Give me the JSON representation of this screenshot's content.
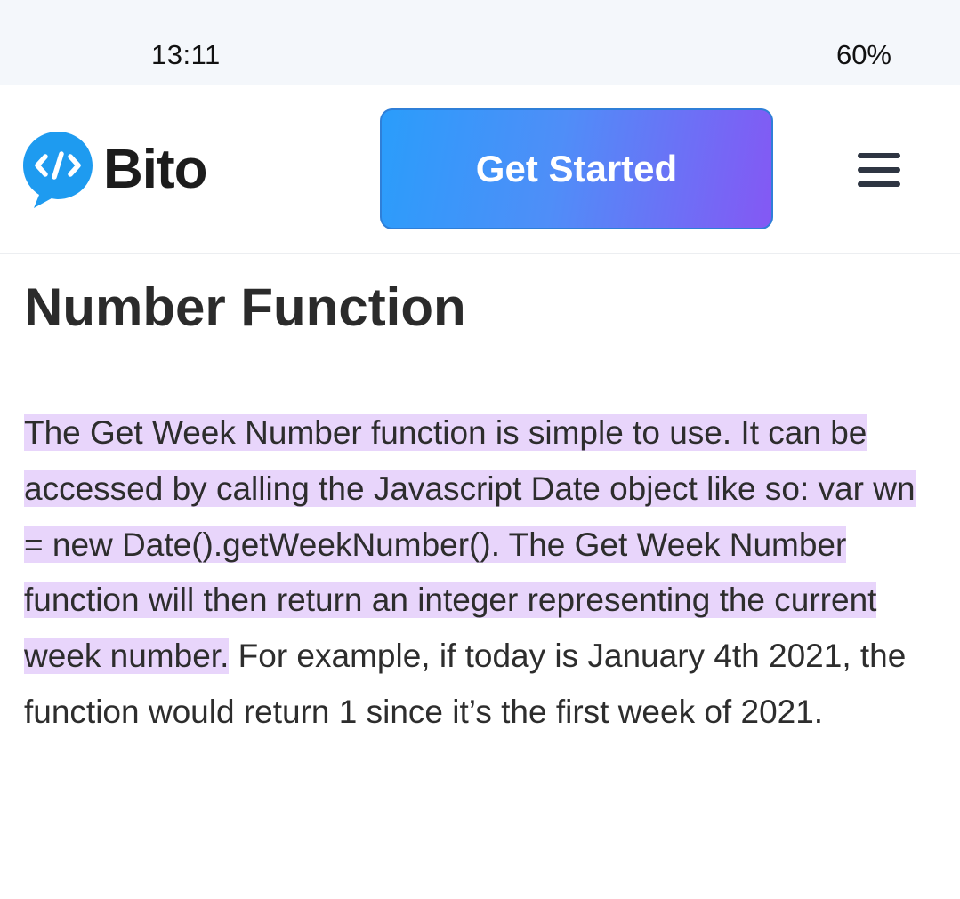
{
  "status": {
    "time": "13:11",
    "battery": "60%"
  },
  "nav": {
    "logo_text": "Bito",
    "cta_label": "Get Started",
    "menu_icon": "hamburger-menu-icon"
  },
  "article": {
    "title": "Number Function",
    "highlighted_text": "The Get Week Number function is simple to use. It can be accessed by calling the Javascript Date object like so: var wn = new Date().getWeekNumber(). The Get Week Number function will then return an integer representing the current week number.",
    "body_text": " For example, if today is January 4th 2021, the function would return 1 since it’s the first week of 2021.",
    "highlight_color": "#e8d5fb"
  },
  "colors": {
    "brand_blue": "#1e9bf0",
    "cta_start": "#2a9dfb",
    "cta_end": "#8458f4"
  }
}
